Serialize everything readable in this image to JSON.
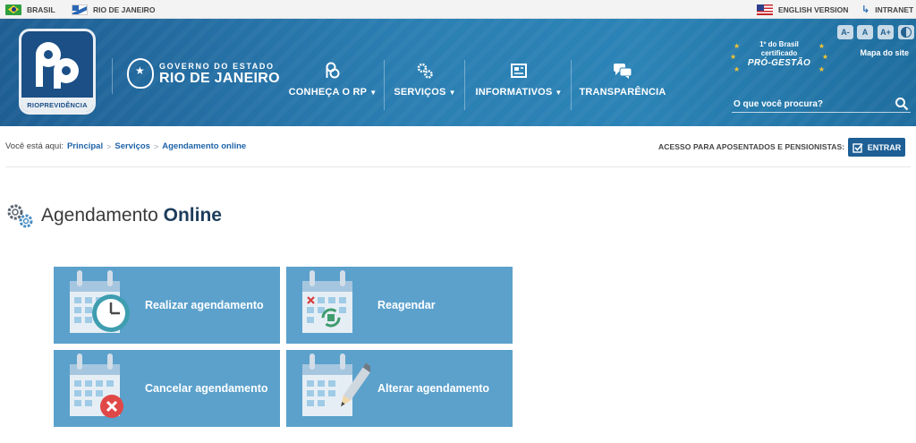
{
  "topbar": {
    "brasil": "BRASIL",
    "rio": "RIO DE JANEIRO",
    "english": "ENGLISH VERSION",
    "intranet": "INTRANET"
  },
  "header": {
    "logo_text": "RIOPREVIDÊNCIA",
    "gov_line1": "GOVERNO DO ESTADO",
    "gov_line2": "RIO DE JANEIRO",
    "nav": [
      {
        "label": "CONHEÇA O RP",
        "icon": "rp-logo-icon",
        "dropdown": true
      },
      {
        "label": "SERVIÇOS",
        "icon": "gears-icon",
        "dropdown": true
      },
      {
        "label": "INFORMATIVOS",
        "icon": "newspaper-icon",
        "dropdown": true
      },
      {
        "label": "TRANSPARÊNCIA",
        "icon": "chat-bubbles-icon",
        "dropdown": false
      }
    ],
    "cert_line1": "1º do Brasil",
    "cert_line2": "certificado",
    "cert_line3": "PRÓ-GESTÃO",
    "font_decrease": "A-",
    "font_normal": "A",
    "font_increase": "A+",
    "mapa": "Mapa do site",
    "search_placeholder": "O que você procura?"
  },
  "breadcrumb": {
    "prefix": "Você está aqui:",
    "items": [
      "Principal",
      "Serviços",
      "Agendamento online"
    ]
  },
  "access": {
    "label": "ACESSO PARA APOSENTADOS E PENSIONISTAS:",
    "button": "ENTRAR"
  },
  "page": {
    "title_regular": "Agendamento",
    "title_bold": "Online"
  },
  "cards": [
    {
      "label": "Realizar agendamento",
      "icon": "calendar-clock-icon"
    },
    {
      "label": "Reagendar",
      "icon": "calendar-refresh-icon"
    },
    {
      "label": "Cancelar agendamento",
      "icon": "calendar-cancel-icon"
    },
    {
      "label": "Alterar agendamento",
      "icon": "calendar-edit-icon"
    }
  ],
  "colors": {
    "header": "#2b7fb3",
    "card": "#5ba1cc",
    "link": "#1f63a8",
    "button": "#1e5f95"
  }
}
